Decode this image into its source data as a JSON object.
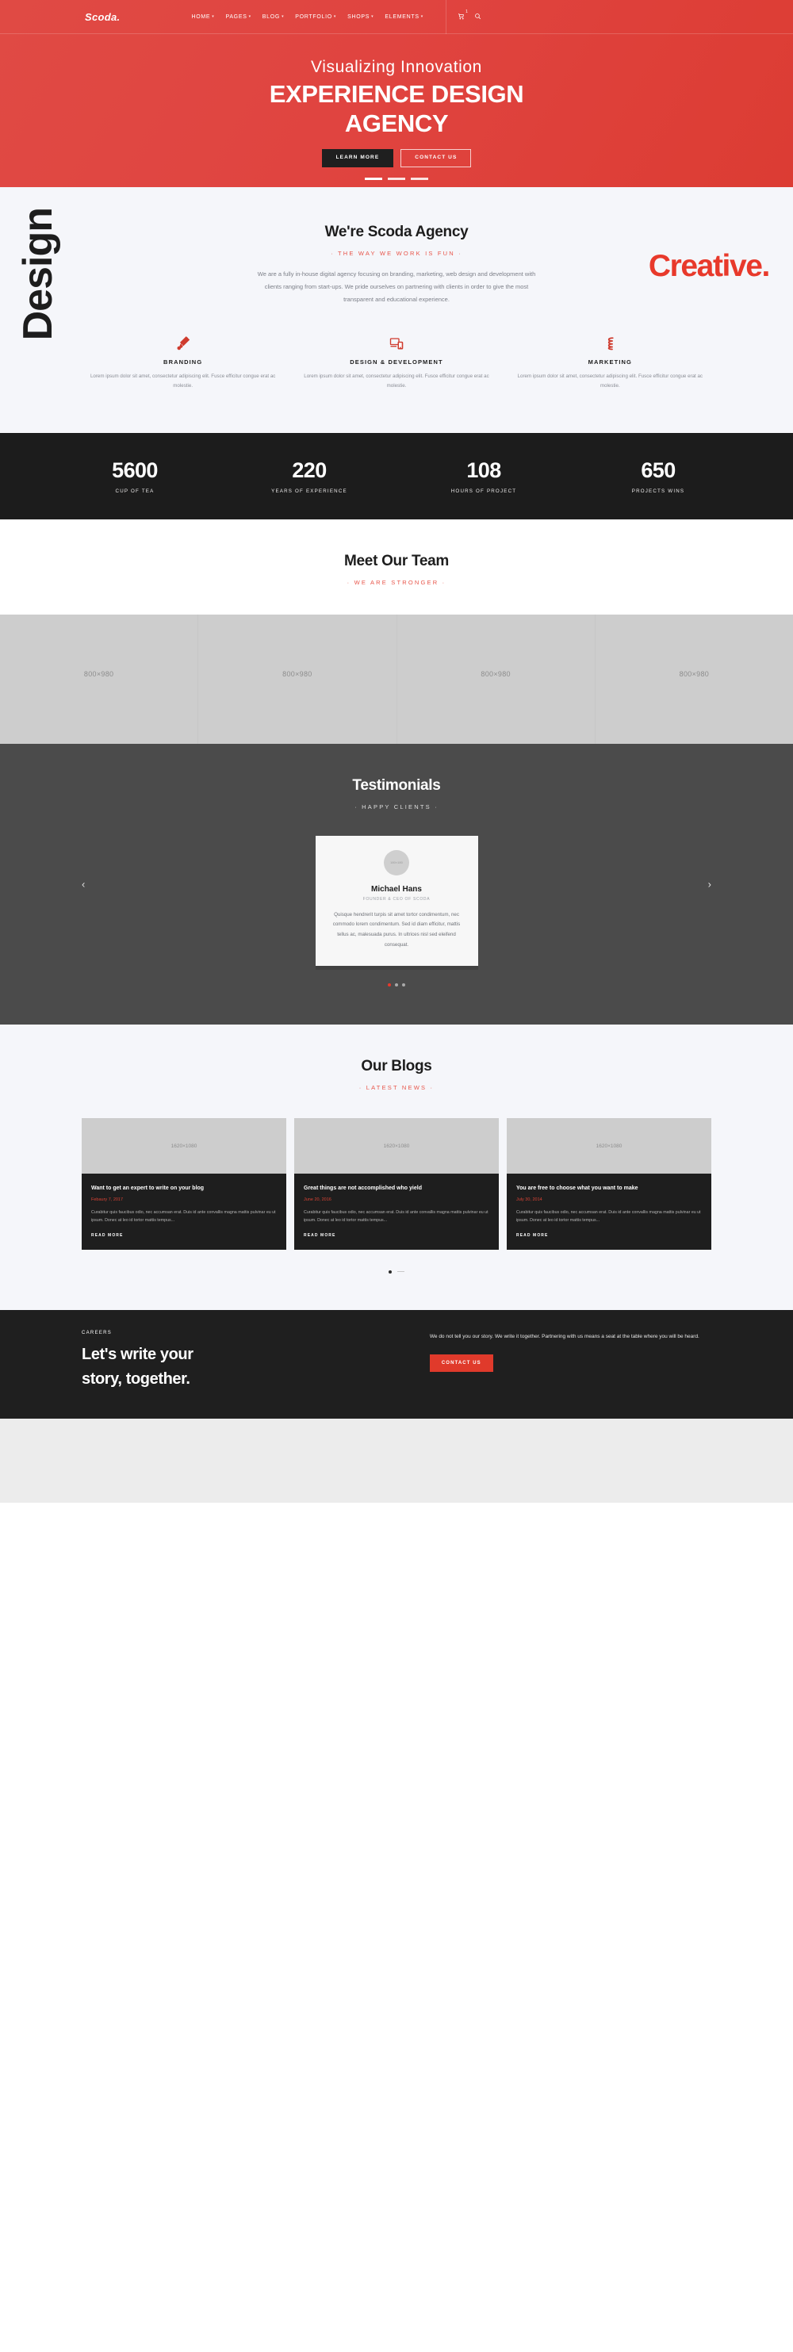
{
  "header": {
    "brand": "Scoda.",
    "nav": [
      {
        "label": "HOME",
        "caret": "▾"
      },
      {
        "label": "PAGES",
        "caret": "▾"
      },
      {
        "label": "BLOG",
        "caret": "▾"
      },
      {
        "label": "PORTFOLIO",
        "caret": "▾"
      },
      {
        "label": "SHOPS",
        "caret": "▾"
      },
      {
        "label": "ELEMENTS",
        "caret": "▾"
      }
    ],
    "cart_icon": "cart-icon",
    "cart_count": "1",
    "search_icon": "search-icon"
  },
  "hero": {
    "subtitle": "Visualizing Innovation",
    "title_line1": "EXPERIENCE DESIGN",
    "title_line2": "AGENCY",
    "primary_button": "LEARN MORE",
    "secondary_button": "CONTACT US",
    "slides": [
      "1",
      "2",
      "3"
    ],
    "bg_color": "#e0443d"
  },
  "about": {
    "side_word_left": "Design",
    "side_word_right": "Creative.",
    "title": "We're Scoda Agency",
    "kicker": "· THE WAY WE WORK IS FUN ·",
    "body": "We are a fully in-house digital agency focusing on branding, marketing, web design and development with clients ranging from start-ups. We pride ourselves on partnering with clients in order to give the most transparent and educational experience.",
    "services": [
      {
        "icon": "paintbrush-icon",
        "title": "BRANDING",
        "text": "Lorem ipsum dolor sit amet, consectetur adipiscing elit. Fusce efficitur congue erat ac molestie."
      },
      {
        "icon": "responsive-devices-icon",
        "title": "DESIGN & DEVELOPMENT",
        "text": "Lorem ipsum dolor sit amet, consectetur adipiscing elit. Fusce efficitur congue erat ac molestie."
      },
      {
        "icon": "marketing-chart-icon",
        "title": "MARKETING",
        "text": "Lorem ipsum dolor sit amet, consectetur adipiscing elit. Fusce efficitur congue erat ac molestie."
      }
    ]
  },
  "stats": [
    {
      "number": "5600",
      "label": "CUP OF TEA"
    },
    {
      "number": "220",
      "label": "YEARS OF EXPERIENCE"
    },
    {
      "number": "108",
      "label": "HOURS OF PROJECT"
    },
    {
      "number": "650",
      "label": "PROJECTS WINS"
    }
  ],
  "team": {
    "title": "Meet Our Team",
    "kicker": "· WE ARE STRONGER ·",
    "members": [
      {
        "placeholder": "800×980"
      },
      {
        "placeholder": "800×980"
      },
      {
        "placeholder": "800×980"
      },
      {
        "placeholder": "800×980"
      }
    ]
  },
  "testimonials": {
    "title": "Testimonials",
    "kicker": "· HAPPY CLIENTS ·",
    "prev_icon": "chevron-left-icon",
    "next_icon": "chevron-right-icon",
    "card": {
      "avatar_placeholder": "180×180",
      "name": "Michael Hans",
      "role": "FOUNDER & CEO OF SCODA",
      "quote": "Quisque hendrerit turpis sit amet tortor condimentum, nec commodo lorem condimentum. Sed id diam efficitur, mattis tellus ac, malesuada purus. In ultrices nisl sed eleifend consequat."
    },
    "dots": [
      "1",
      "2",
      "3"
    ],
    "active_dot": 0
  },
  "blog": {
    "title": "Our Blogs",
    "kicker": "· LATEST NEWS ·",
    "posts": [
      {
        "image_placeholder": "1620×1080",
        "title": "Want to get an expert to write on your blog",
        "date": "Febaury 7, 2017",
        "excerpt": "Curabitur quis faucibus odio, nec accumsan erat. Duis id ante convallis magna mattis pulvinar eu ut ipsum. Donec at leo id tortor mattis tempus...",
        "read_more": "READ MORE"
      },
      {
        "image_placeholder": "1620×1080",
        "title": "Great things are not accomplished who yield",
        "date": "June 20, 2016",
        "excerpt": "Curabitur quis faucibus odio, nec accumsan erat. Duis id ante convallis magna mattis pulvinar eu ut ipsum. Donec at leo id tortor mattis tempus...",
        "read_more": "READ MORE"
      },
      {
        "image_placeholder": "1620×1080",
        "title": "You are free to choose what you want to make",
        "date": "July 30, 2014",
        "excerpt": "Curabitur quis faucibus odio, nec accumsan erat. Duis id ante convallis magna mattis pulvinar eu ut ipsum. Donec at leo id tortor mattis tempus...",
        "read_more": "READ MORE"
      }
    ]
  },
  "cta": {
    "kicker": "CAREERS",
    "title_line1": "Let's write your",
    "title_line2": "story, together.",
    "text": "We do not tell you our story. We write it together. Partnering with us means a seat at the table where you will be heard.",
    "button": "CONTACT US",
    "button_color": "#e03a2b"
  }
}
